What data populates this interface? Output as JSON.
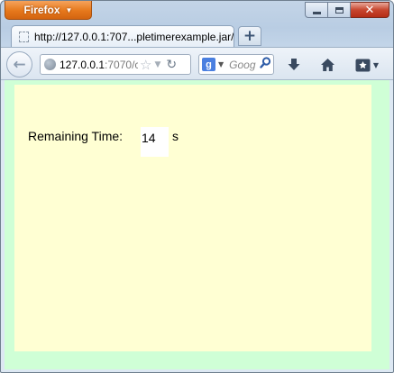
{
  "browser": {
    "menu_button_label": "Firefox",
    "tab": {
      "title": "http://127.0.0.1:707...pletimerexample.jar/"
    },
    "urlbar": {
      "host": "127.0.0.1",
      "rest": ":7070/c"
    },
    "search": {
      "engine_glyph": "g",
      "placeholder": "Goog"
    }
  },
  "icons": {
    "back": "back-arrow-icon",
    "globe": "globe-icon",
    "star": "bookmark-star-icon",
    "reload": "reload-icon",
    "download": "download-icon",
    "home": "home-icon",
    "bookmarks_menu": "bookmarks-menu-icon"
  },
  "applet": {
    "label": "Remaining Time:",
    "value": "14",
    "unit": "s"
  },
  "colors": {
    "page_background": "#cfffd6",
    "applet_background": "#ffffd3",
    "firefox_button": "#e6781c"
  }
}
